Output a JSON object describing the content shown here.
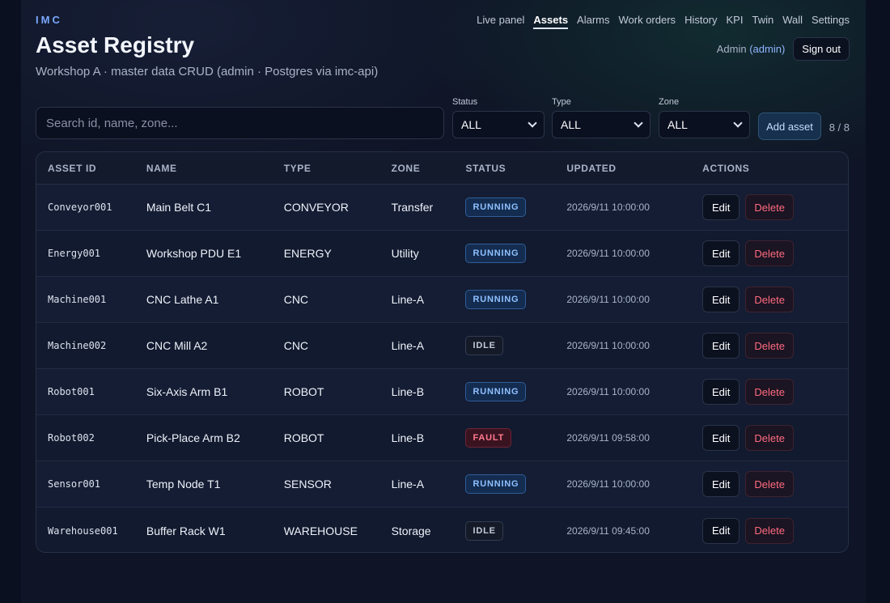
{
  "brand": "IMC",
  "page": {
    "title": "Asset Registry",
    "subtitle": "Workshop A · master data CRUD (admin · Postgres via imc-api)"
  },
  "nav": [
    {
      "label": "Live panel",
      "active": false
    },
    {
      "label": "Assets",
      "active": true
    },
    {
      "label": "Alarms",
      "active": false
    },
    {
      "label": "Work orders",
      "active": false
    },
    {
      "label": "History",
      "active": false
    },
    {
      "label": "KPI",
      "active": false
    },
    {
      "label": "Twin",
      "active": false
    },
    {
      "label": "Wall",
      "active": false
    },
    {
      "label": "Settings",
      "active": false
    }
  ],
  "user": {
    "name": "Admin",
    "role": "(admin)",
    "signout_label": "Sign out"
  },
  "filters": {
    "search_placeholder": "Search id, name, zone...",
    "status": {
      "label": "Status",
      "value": "ALL"
    },
    "type": {
      "label": "Type",
      "value": "ALL"
    },
    "zone": {
      "label": "Zone",
      "value": "ALL"
    },
    "add_label": "Add asset",
    "count": "8 / 8"
  },
  "table": {
    "columns": [
      "ASSET ID",
      "NAME",
      "TYPE",
      "ZONE",
      "STATUS",
      "UPDATED",
      "ACTIONS"
    ],
    "edit_label": "Edit",
    "delete_label": "Delete",
    "rows": [
      {
        "id": "Conveyor001",
        "name": "Main Belt C1",
        "type": "CONVEYOR",
        "zone": "Transfer",
        "status": "RUNNING",
        "updated": "2026/9/11 10:00:00"
      },
      {
        "id": "Energy001",
        "name": "Workshop PDU E1",
        "type": "ENERGY",
        "zone": "Utility",
        "status": "RUNNING",
        "updated": "2026/9/11 10:00:00"
      },
      {
        "id": "Machine001",
        "name": "CNC Lathe A1",
        "type": "CNC",
        "zone": "Line-A",
        "status": "RUNNING",
        "updated": "2026/9/11 10:00:00"
      },
      {
        "id": "Machine002",
        "name": "CNC Mill A2",
        "type": "CNC",
        "zone": "Line-A",
        "status": "IDLE",
        "updated": "2026/9/11 10:00:00"
      },
      {
        "id": "Robot001",
        "name": "Six-Axis Arm B1",
        "type": "ROBOT",
        "zone": "Line-B",
        "status": "RUNNING",
        "updated": "2026/9/11 10:00:00"
      },
      {
        "id": "Robot002",
        "name": "Pick-Place Arm B2",
        "type": "ROBOT",
        "zone": "Line-B",
        "status": "FAULT",
        "updated": "2026/9/11 09:58:00"
      },
      {
        "id": "Sensor001",
        "name": "Temp Node T1",
        "type": "SENSOR",
        "zone": "Line-A",
        "status": "RUNNING",
        "updated": "2026/9/11 10:00:00"
      },
      {
        "id": "Warehouse001",
        "name": "Buffer Rack W1",
        "type": "WAREHOUSE",
        "zone": "Storage",
        "status": "IDLE",
        "updated": "2026/9/11 09:45:00"
      }
    ]
  }
}
